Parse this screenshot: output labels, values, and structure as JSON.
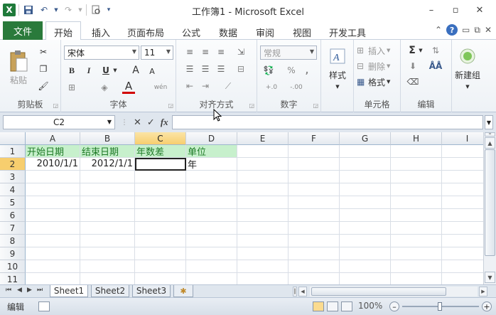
{
  "window": {
    "title": "工作簿1 - Microsoft Excel"
  },
  "qat": {
    "app_icon_text": "X"
  },
  "tabs": {
    "file": "文件",
    "items": [
      "开始",
      "插入",
      "页面布局",
      "公式",
      "数据",
      "审阅",
      "视图",
      "开发工具"
    ]
  },
  "ribbon": {
    "clipboard": {
      "paste": "粘贴",
      "label": "剪贴板"
    },
    "font": {
      "name": "宋体",
      "size": "11",
      "bold": "B",
      "italic": "I",
      "underline": "U",
      "grow": "A",
      "shrink": "A",
      "font_color": "A",
      "wen": "wén",
      "label": "字体"
    },
    "alignment": {
      "label": "对齐方式"
    },
    "number": {
      "format": "常规",
      "percent": "%",
      "comma": ",",
      "inc": "+.0",
      "dec": "-.00",
      "label": "数字"
    },
    "styles": {
      "button": "样式"
    },
    "cells": {
      "insert": "插入",
      "delete": "删除",
      "format": "格式",
      "label": "单元格"
    },
    "editing": {
      "sigma": "Σ",
      "label": "编辑"
    },
    "new_group": {
      "button": "新建组"
    }
  },
  "formula_bar": {
    "name_box": "C2",
    "fx": "fx",
    "cancel": "✕",
    "enter": "✓",
    "value": ""
  },
  "grid": {
    "columns": [
      "A",
      "B",
      "C",
      "D",
      "E",
      "F",
      "G",
      "H",
      "I"
    ],
    "rows": [
      "1",
      "2",
      "3",
      "4",
      "5",
      "6",
      "7",
      "8",
      "9",
      "10",
      "11"
    ],
    "header_cells": [
      "开始日期",
      "结束日期",
      "年数差",
      "单位"
    ],
    "row2": {
      "a": "2010/1/1",
      "b": "2012/1/1",
      "c": "",
      "d": "年"
    },
    "active_cell": "C2"
  },
  "sheets": [
    "Sheet1",
    "Sheet2",
    "Sheet3"
  ],
  "status": {
    "mode": "编辑",
    "zoom": "100%"
  },
  "colors": {
    "file_tab": "#2a7a3b",
    "header_fill": "#c7f0cc",
    "header_text": "#1e7a26",
    "selection": "#f7ce6e"
  }
}
